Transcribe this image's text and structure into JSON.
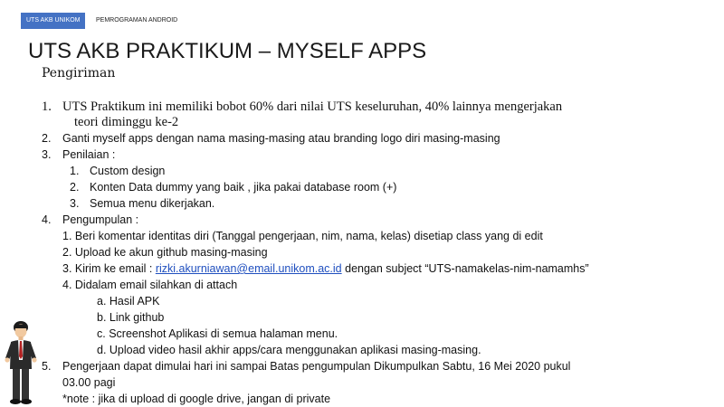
{
  "header": {
    "badge": "UTS AKB UNIKOM",
    "course": "PEMROGRAMAN ANDROID"
  },
  "title": "UTS AKB PRAKTIKUM – MYSELF APPS",
  "subtitle": "Pengiriman",
  "items": {
    "i1": {
      "num": "1.",
      "line1": "UTS Praktikum ini memiliki bobot 60% dari nilai UTS keseluruhan, 40% lainnya mengerjakan",
      "line2": "teori diminggu ke-2"
    },
    "i2": {
      "num": "2.",
      "text": "Ganti myself apps dengan nama masing-masing atau branding logo diri masing-masing"
    },
    "i3": {
      "num": "3.",
      "text": "Penilaian :",
      "sub1": {
        "num": "1.",
        "text": "Custom design"
      },
      "sub2": {
        "num": "2.",
        "text": "Konten Data dummy yang baik , jika pakai database room (+)"
      },
      "sub3": {
        "num": "3.",
        "text": "Semua menu dikerjakan."
      }
    },
    "i4": {
      "num": "4.",
      "text": "Pengumpulan :",
      "sub1": "1. Beri komentar identitas diri (Tanggal pengerjaan, nim, nama, kelas) disetiap class yang di edit",
      "sub2": "2. Upload ke akun github masing-masing",
      "sub3_prefix": "3. Kirim ke email : ",
      "sub3_email": "rizki.akurniawan@email.unikom.ac.id",
      "sub3_suffix": " dengan subject “UTS-namakelas-nim-namamhs”",
      "sub4": "4. Didalam email silahkan di attach",
      "a": "a. Hasil APK",
      "b": "b. Link github",
      "c": "c. Screenshot Aplikasi di semua halaman menu.",
      "d": "d. Upload video hasil akhir apps/cara menggunakan aplikasi masing-masing."
    },
    "i5": {
      "num": "5.",
      "line1": "Pengerjaan dapat dimulai hari ini sampai Batas pengumpulan Dikumpulkan Sabtu, 16 Mei 2020  pukul",
      "line2": "03.00  pagi"
    }
  },
  "note": "*note : jika di upload di google drive, jangan di private",
  "colors": {
    "badge_bg": "#4472c4",
    "link": "#1f4fbf"
  }
}
